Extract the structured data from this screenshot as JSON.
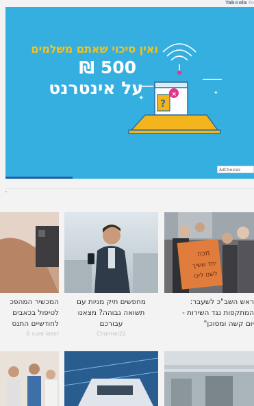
{
  "brand": {
    "logo": "Tab",
    "logo2": "ola",
    "suffix": "Fo"
  },
  "ad": {
    "line1": "ואין סיכוי שאתם משלמים",
    "line2": "500 ₪",
    "line3": "על אינטרנט",
    "adchoices": "AdChoices",
    "progress": 0.27,
    "colors": {
      "background": "#35aee0",
      "accent": "#f6c21a",
      "laptop": "#f4b51c"
    }
  },
  "cards": [
    {
      "title_lines": [
        "ראש השב\"כ לשעבר:",
        "המתקפות נגד השירות -",
        "יום קשה ומסוכן\""
      ],
      "source": ""
    },
    {
      "title_lines": [
        "מחפשים תיק מניות עם",
        "תשואה גבוהה? מצאנו",
        "עבורכם"
      ],
      "source": "Channel22"
    },
    {
      "title_lines": [
        "המכשיר המהפכ",
        "לטיפול בכאבים",
        "לחודשיים התנס"
      ],
      "source": "B cure laser"
    }
  ],
  "sign_text": [
    "מכה",
    "יחד ששיך",
    "לשנו ליבו"
  ]
}
